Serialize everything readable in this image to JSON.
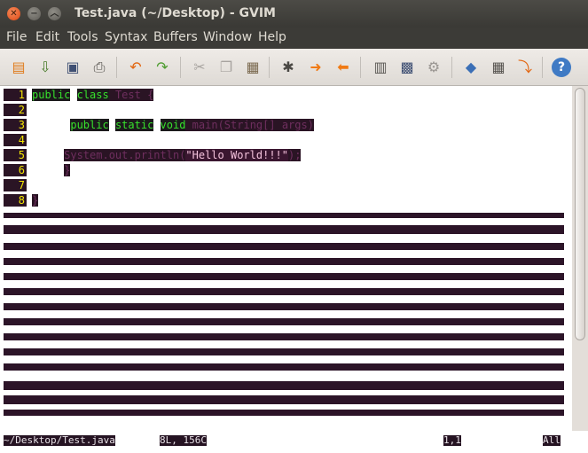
{
  "window": {
    "title": "Test.java (~/Desktop) - GVIM"
  },
  "menu": [
    "File",
    "Edit",
    "Tools",
    "Syntax",
    "Buffers",
    "Window",
    "Help"
  ],
  "toolbar": {
    "icons": [
      "open-file-icon",
      "save-download-icon",
      "save-icon",
      "print-icon",
      "undo-icon",
      "redo-icon",
      "cut-icon",
      "copy-icon",
      "paste-icon",
      "find-replace-icon",
      "find-next-icon",
      "find-prev-icon",
      "load-session-icon",
      "save-session-icon",
      "run-script-icon",
      "make-icon",
      "table-icon",
      "jump-tag-icon",
      "help-icon"
    ]
  },
  "editor": {
    "lines": [
      {
        "num": "1",
        "parts": [
          {
            "t": "public",
            "c": "kw"
          },
          {
            "t": " ",
            "c": ""
          },
          {
            "t": "class",
            "c": "kw"
          },
          {
            "t": " Test ",
            "c": "plain"
          },
          {
            "t": "{",
            "c": "plain"
          }
        ]
      },
      {
        "num": "2",
        "parts": []
      },
      {
        "num": "3",
        "parts": [
          {
            "t": "      ",
            "c": ""
          },
          {
            "t": "public",
            "c": "kw"
          },
          {
            "t": " ",
            "c": ""
          },
          {
            "t": "static",
            "c": "kw"
          },
          {
            "t": " ",
            "c": ""
          },
          {
            "t": "void",
            "c": "kw"
          },
          {
            "t": " main(String[] args)",
            "c": "plain"
          }
        ]
      },
      {
        "num": "4",
        "parts": []
      },
      {
        "num": "5",
        "parts": [
          {
            "t": "     ",
            "c": ""
          },
          {
            "t": "System.out.println(",
            "c": "plain"
          },
          {
            "t": "\"Hello World!!!\"",
            "c": "str"
          },
          {
            "t": ");",
            "c": "plain"
          }
        ]
      },
      {
        "num": "6",
        "parts": [
          {
            "t": "     ",
            "c": ""
          },
          {
            "t": "}",
            "c": "plain"
          }
        ]
      },
      {
        "num": "7",
        "parts": []
      },
      {
        "num": "8",
        "parts": [
          {
            "t": "}",
            "c": "plain"
          }
        ]
      }
    ]
  },
  "status": {
    "file": "~/Desktop/Test.java",
    "info": "8L, 156C",
    "position": "1,1",
    "scroll": "All"
  },
  "colors": {
    "keyword": "#37e12c",
    "line_number": "#f3e600",
    "string": "#f4c2dc",
    "title_bar": "#3c3b37",
    "close_button": "#dd4814"
  }
}
